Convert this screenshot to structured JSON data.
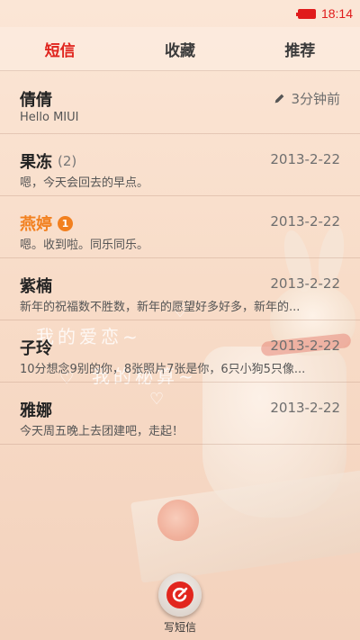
{
  "status_bar": {
    "time": "18:14"
  },
  "tabs": [
    {
      "label": "短信",
      "active": true
    },
    {
      "label": "收藏",
      "active": false
    },
    {
      "label": "推荐",
      "active": false
    }
  ],
  "conversations": [
    {
      "name": "倩倩",
      "count": "",
      "badge": "",
      "date": "3分钟前",
      "preview": "Hello MIUI",
      "draft_icon": "pencil-icon"
    },
    {
      "name": "果冻",
      "count": "(2)",
      "badge": "",
      "date": "2013-2-22",
      "preview": "嗯，今天会回去的早点。"
    },
    {
      "name": "燕婷",
      "count": "",
      "badge": "1",
      "date": "2013-2-22",
      "preview": "嗯。收到啦。同乐同乐。",
      "highlight_color": "#f2801f"
    },
    {
      "name": "紫楠",
      "count": "",
      "badge": "",
      "date": "2013-2-22",
      "preview": "新年的祝福数不胜数，新年的愿望好多好多，新年的..."
    },
    {
      "name": "子玲",
      "count": "",
      "badge": "",
      "date": "2013-2-22",
      "preview": "10分想念9别的你，8张照片7张是你，6只小狗5只像..."
    },
    {
      "name": "雅娜",
      "count": "",
      "badge": "",
      "date": "2013-2-22",
      "preview": "今天周五晚上去团建吧，走起！"
    }
  ],
  "compose": {
    "label": "写短信",
    "icon": "compose-icon"
  },
  "wallpaper_text": {
    "line1": "我的爱恋~",
    "line2": "我的秘算~"
  },
  "colors": {
    "accent": "#e0241d",
    "unread": "#f2801f"
  }
}
